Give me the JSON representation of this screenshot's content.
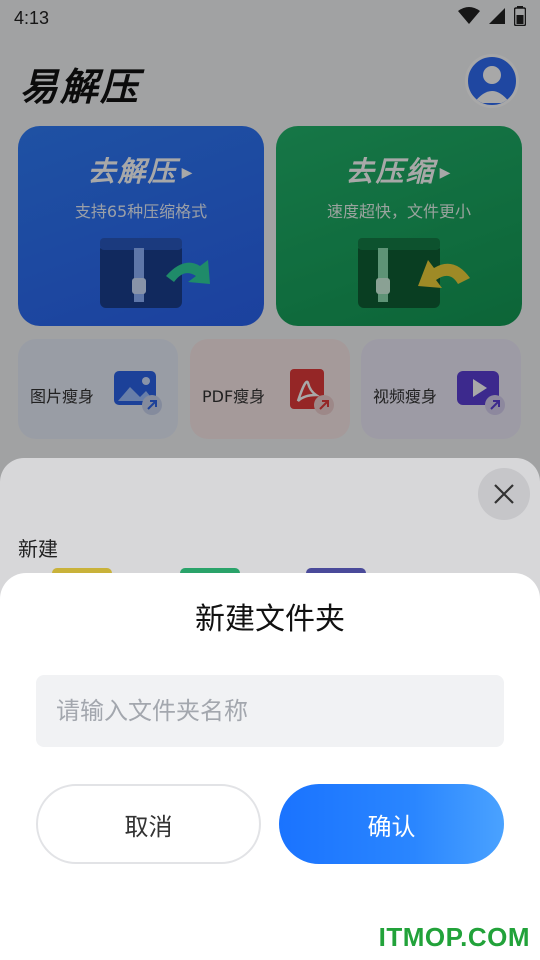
{
  "status_bar": {
    "time": "4:13",
    "icons": [
      "wifi-icon",
      "signal-icon",
      "battery-icon"
    ]
  },
  "header": {
    "app_title": "易解压",
    "avatar_icon": "user-avatar-icon"
  },
  "cards": {
    "unzip": {
      "title": "去解压",
      "subtitle": "支持65种压缩格式",
      "color": "#2f6df5"
    },
    "zip": {
      "title": "去压缩",
      "subtitle": "速度超快，文件更小",
      "color": "#1aa35f"
    }
  },
  "tools": [
    {
      "label": "图片瘦身",
      "icon": "image-compress-icon"
    },
    {
      "label": "PDF瘦身",
      "icon": "pdf-compress-icon"
    },
    {
      "label": "视频瘦身",
      "icon": "video-compress-icon"
    }
  ],
  "sheet": {
    "label": "新建",
    "close_icon": "close-icon"
  },
  "dialog": {
    "title": "新建文件夹",
    "input_value": "",
    "input_placeholder": "请输入文件夹名称",
    "cancel_label": "取消",
    "confirm_label": "确认"
  },
  "watermark": "ITMOP.COM",
  "colors": {
    "accent_blue": "#1a73ff",
    "accent_green": "#1aa35f",
    "watermark_green": "#22a23a"
  }
}
